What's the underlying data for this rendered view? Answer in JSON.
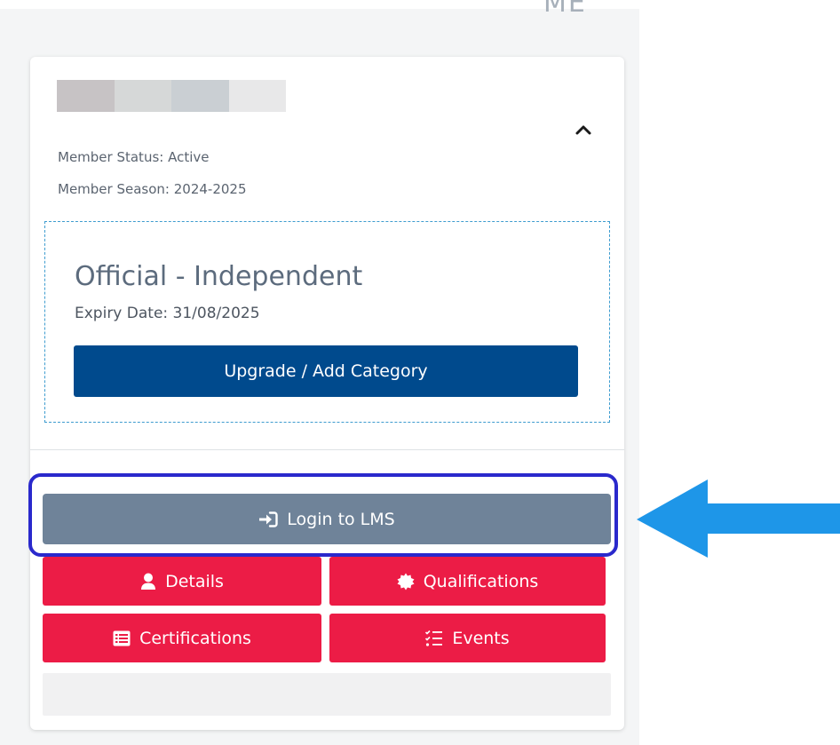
{
  "header": {
    "partial_title": "ME"
  },
  "member": {
    "status": "Member Status: Active",
    "season": "Member Season: 2024-2025"
  },
  "category": {
    "title": "Official - Independent",
    "expiry": "Expiry Date: 31/08/2025",
    "upgrade_label": "Upgrade / Add Category"
  },
  "actions": {
    "lms_label": "Login to LMS",
    "details_label": "Details",
    "qualifications_label": "Qualifications",
    "certifications_label": "Certifications",
    "events_label": "Events"
  },
  "icons": {
    "collapse": "chevron-up-icon",
    "lms": "sign-in-icon",
    "details": "user-icon",
    "qualifications": "certificate-badge-icon",
    "certifications": "list-alt-icon",
    "events": "tasks-list-icon",
    "pointer": "arrow-left-icon"
  },
  "colors": {
    "primary_blue": "#004a8d",
    "lms_gray": "#6f8399",
    "action_red": "#ec1c46",
    "highlight_border": "#2a29cc",
    "arrow_blue": "#1e96e8",
    "dashed_border": "#3e9ccf"
  }
}
